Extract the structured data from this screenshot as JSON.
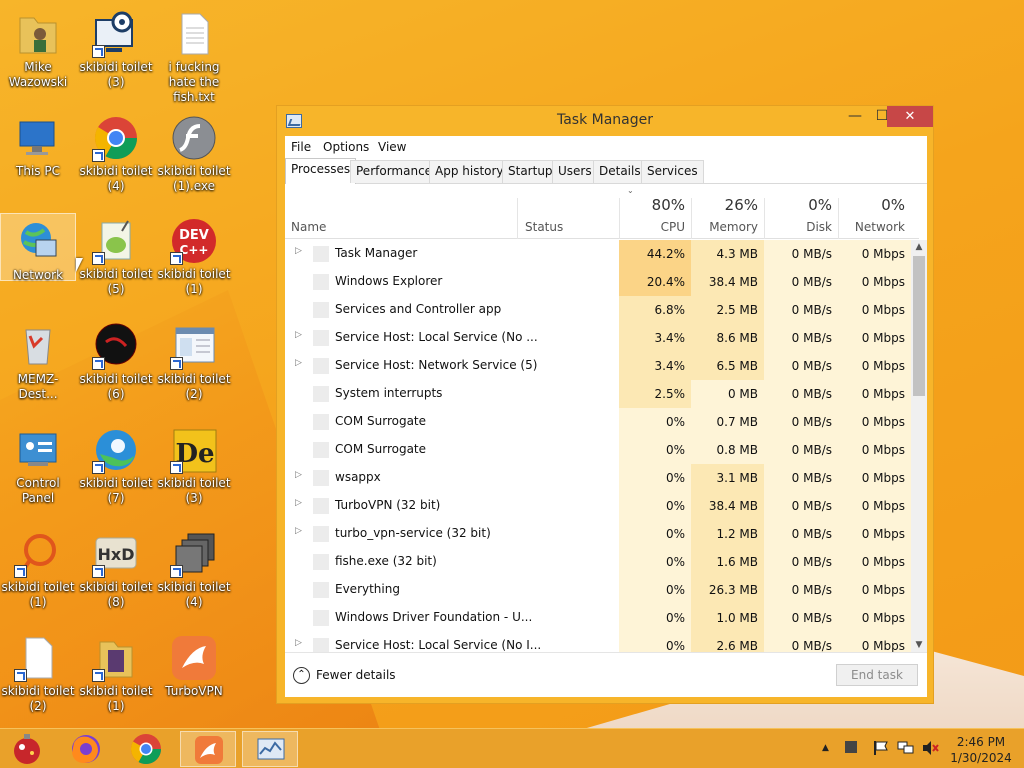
{
  "desktop": {
    "icons": [
      {
        "label": "Mike Wazowski"
      },
      {
        "label": "skibidi toilet (3)"
      },
      {
        "label": "i fucking hate the fish.txt"
      },
      {
        "label": "This PC"
      },
      {
        "label": "skibidi toilet (4)"
      },
      {
        "label": "skibidi toilet (1).exe"
      },
      {
        "label": "Network"
      },
      {
        "label": "skibidi toilet (5)"
      },
      {
        "label": "skibidi toilet (1)"
      },
      {
        "label": "MEMZ-Dest..."
      },
      {
        "label": "skibidi toilet (6)"
      },
      {
        "label": "skibidi toilet (2)"
      },
      {
        "label": "Control Panel"
      },
      {
        "label": "skibidi toilet (7)"
      },
      {
        "label": "skibidi toilet (3)"
      },
      {
        "label": "skibidi toilet (1)"
      },
      {
        "label": "skibidi toilet (8)"
      },
      {
        "label": "skibidi toilet (4)"
      },
      {
        "label": "skibidi toilet (2)"
      },
      {
        "label": "skibidi toilet (1)"
      },
      {
        "label": "TurboVPN"
      }
    ],
    "dev_icon_text": "DEV",
    "dev_icon_sub": "C++",
    "hxd_text": "HxD",
    "de_text": "De"
  },
  "window": {
    "title": "Task Manager",
    "minimize": "—",
    "maximize": "☐",
    "close": "✕"
  },
  "menu": {
    "file": "File",
    "options": "Options",
    "view": "View"
  },
  "tabs": [
    "Processes",
    "Performance",
    "App history",
    "Startup",
    "Users",
    "Details",
    "Services"
  ],
  "columns": {
    "name": "Name",
    "status": "Status",
    "cpu_pct": "80%",
    "cpu": "CPU",
    "mem_pct": "26%",
    "mem": "Memory",
    "disk_pct": "0%",
    "disk": "Disk",
    "net_pct": "0%",
    "net": "Network",
    "sort_glyph": "⌄"
  },
  "rows": [
    {
      "name": "Task Manager",
      "expand": "▷",
      "cpu": "44.2%",
      "mem": "4.3 MB",
      "disk": "0 MB/s",
      "net": "0 Mbps"
    },
    {
      "name": "Windows Explorer",
      "expand": "",
      "cpu": "20.4%",
      "mem": "38.4 MB",
      "disk": "0 MB/s",
      "net": "0 Mbps"
    },
    {
      "name": "Services and Controller app",
      "expand": "",
      "cpu": "6.8%",
      "mem": "2.5 MB",
      "disk": "0 MB/s",
      "net": "0 Mbps"
    },
    {
      "name": "Service Host: Local Service (No ...",
      "expand": "▷",
      "cpu": "3.4%",
      "mem": "8.6 MB",
      "disk": "0 MB/s",
      "net": "0 Mbps"
    },
    {
      "name": "Service Host: Network Service (5)",
      "expand": "▷",
      "cpu": "3.4%",
      "mem": "6.5 MB",
      "disk": "0 MB/s",
      "net": "0 Mbps"
    },
    {
      "name": "System interrupts",
      "expand": "",
      "cpu": "2.5%",
      "mem": "0 MB",
      "disk": "0 MB/s",
      "net": "0 Mbps"
    },
    {
      "name": "COM Surrogate",
      "expand": "",
      "cpu": "0%",
      "mem": "0.7 MB",
      "disk": "0 MB/s",
      "net": "0 Mbps"
    },
    {
      "name": "COM Surrogate",
      "expand": "",
      "cpu": "0%",
      "mem": "0.8 MB",
      "disk": "0 MB/s",
      "net": "0 Mbps"
    },
    {
      "name": "wsappx",
      "expand": "▷",
      "cpu": "0%",
      "mem": "3.1 MB",
      "disk": "0 MB/s",
      "net": "0 Mbps"
    },
    {
      "name": "TurboVPN (32 bit)",
      "expand": "▷",
      "cpu": "0%",
      "mem": "38.4 MB",
      "disk": "0 MB/s",
      "net": "0 Mbps"
    },
    {
      "name": "turbo_vpn-service (32 bit)",
      "expand": "▷",
      "cpu": "0%",
      "mem": "1.2 MB",
      "disk": "0 MB/s",
      "net": "0 Mbps"
    },
    {
      "name": "fishe.exe (32 bit)",
      "expand": "",
      "cpu": "0%",
      "mem": "1.6 MB",
      "disk": "0 MB/s",
      "net": "0 Mbps"
    },
    {
      "name": "Everything",
      "expand": "",
      "cpu": "0%",
      "mem": "26.3 MB",
      "disk": "0 MB/s",
      "net": "0 Mbps"
    },
    {
      "name": "Windows Driver Foundation - U...",
      "expand": "",
      "cpu": "0%",
      "mem": "1.0 MB",
      "disk": "0 MB/s",
      "net": "0 Mbps"
    },
    {
      "name": "Service Host: Local Service (No I...",
      "expand": "▷",
      "cpu": "0%",
      "mem": "2.6 MB",
      "disk": "0 MB/s",
      "net": "0 Mbps"
    }
  ],
  "scroll": {
    "up": "▲",
    "down": "▼"
  },
  "footer": {
    "fewer_details": "Fewer details",
    "fewer_glyph": "⌃",
    "end_task": "End task"
  },
  "heat": {
    "high": "#fbd487",
    "mid": "#fce8b4",
    "low": "#fef4d7"
  },
  "taskbar": {
    "tray_arrow": "▲",
    "time": "2:46 PM",
    "date": "1/30/2024"
  }
}
